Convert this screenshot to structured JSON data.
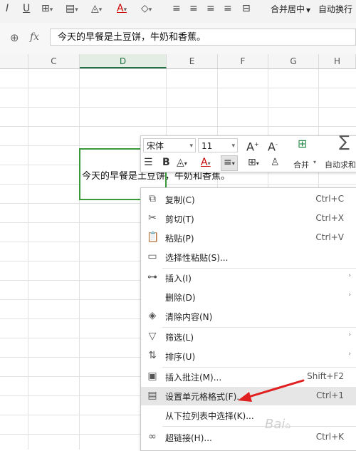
{
  "ribbon": {
    "merge_center": "合并居中",
    "auto_wrap": "自动换行"
  },
  "formula_bar": {
    "fx_label": "fx",
    "value": "今天的早餐是土豆饼，牛奶和香蕉。"
  },
  "columns": [
    "C",
    "D",
    "E",
    "F",
    "G",
    "H"
  ],
  "cell": {
    "text": "今天的早餐是土豆饼，牛奶和香蕉。"
  },
  "mini_toolbar": {
    "font_name": "宋体",
    "font_size": "11",
    "merge_label": "合并",
    "autosum_label": "自动求和"
  },
  "context_menu": {
    "items": [
      {
        "label": "复制(C)",
        "shortcut": "Ctrl+C",
        "icon": "copy-icon"
      },
      {
        "label": "剪切(T)",
        "shortcut": "Ctrl+X",
        "icon": "scissors-icon"
      },
      {
        "label": "粘贴(P)",
        "shortcut": "Ctrl+V",
        "icon": "paste-icon"
      },
      {
        "label": "选择性粘贴(S)...",
        "shortcut": "",
        "icon": "paste-special-icon"
      },
      {
        "label": "插入(I)",
        "shortcut": "",
        "icon": "insert-icon"
      },
      {
        "label": "删除(D)",
        "shortcut": "",
        "icon": ""
      },
      {
        "label": "清除内容(N)",
        "shortcut": "",
        "icon": "eraser-icon"
      },
      {
        "label": "筛选(L)",
        "shortcut": "",
        "icon": "filter-icon"
      },
      {
        "label": "排序(U)",
        "shortcut": "",
        "icon": "sort-icon"
      },
      {
        "label": "插入批注(M)...",
        "shortcut": "Shift+F2",
        "icon": "comment-icon"
      },
      {
        "label": "设置单元格格式(F)...",
        "shortcut": "Ctrl+1",
        "icon": "format-cells-icon"
      },
      {
        "label": "从下拉列表中选择(K)...",
        "shortcut": "",
        "icon": ""
      },
      {
        "label": "超链接(H)...",
        "shortcut": "Ctrl+K",
        "icon": "link-icon"
      }
    ]
  },
  "colors": {
    "selection_green": "#3a9a3a",
    "arrow_red": "#e02020"
  }
}
